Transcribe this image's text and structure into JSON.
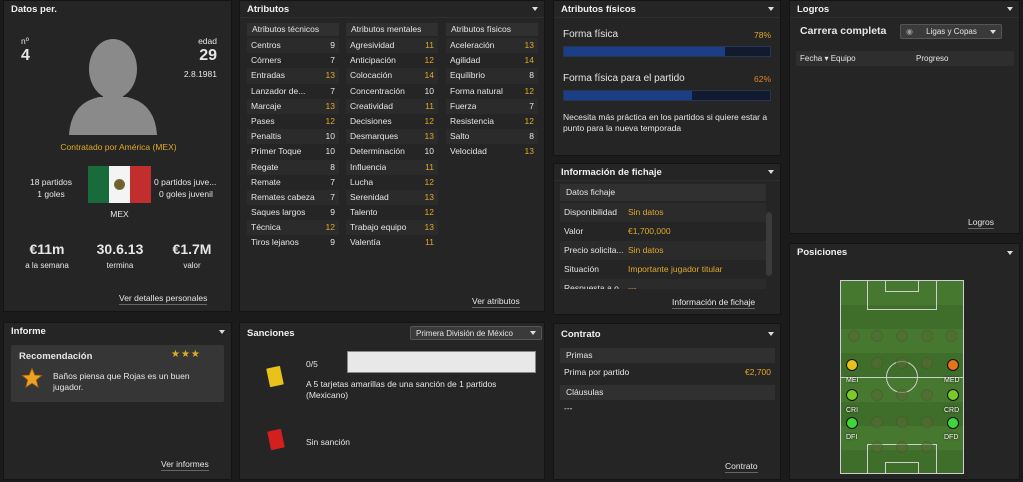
{
  "personal": {
    "title": "Datos per.",
    "num_label": "nº",
    "num": "4",
    "age_label": "edad",
    "age": "29",
    "dob": "2.8.1981",
    "contract": "Contratado por América (MEX)",
    "matches": "18 partidos",
    "goals": "1 goles",
    "youth_matches": "0 partidos juve...",
    "youth_goals": "0 goles juvenil",
    "nation": "MEX",
    "wage": "€11m",
    "wage_label": "a la semana",
    "end": "30.6.13",
    "end_label": "termina",
    "value": "€1.7M",
    "value_label": "valor",
    "link": "Ver detalles personales"
  },
  "attributes": {
    "title": "Atributos",
    "link": "Ver atributos",
    "technical": {
      "header": "Atributos técnicos",
      "rows": [
        {
          "n": "Centros",
          "v": "9"
        },
        {
          "n": "Córners",
          "v": "7"
        },
        {
          "n": "Entradas",
          "v": "13"
        },
        {
          "n": "Lanzador de...",
          "v": "7"
        },
        {
          "n": "Marcaje",
          "v": "13"
        },
        {
          "n": "Pases",
          "v": "12"
        },
        {
          "n": "Penaltis",
          "v": "10"
        },
        {
          "n": "Primer Toque",
          "v": "10"
        },
        {
          "n": "Regate",
          "v": "8"
        },
        {
          "n": "Remate",
          "v": "7"
        },
        {
          "n": "Remates cabeza",
          "v": "7"
        },
        {
          "n": "Saques largos",
          "v": "9"
        },
        {
          "n": "Técnica",
          "v": "12"
        },
        {
          "n": "Tiros lejanos",
          "v": "9"
        }
      ]
    },
    "mental": {
      "header": "Atributos mentales",
      "rows": [
        {
          "n": "Agresividad",
          "v": "11"
        },
        {
          "n": "Anticipación",
          "v": "12"
        },
        {
          "n": "Colocación",
          "v": "14"
        },
        {
          "n": "Concentración",
          "v": "10"
        },
        {
          "n": "Creatividad",
          "v": "11"
        },
        {
          "n": "Decisiones",
          "v": "12"
        },
        {
          "n": "Desmarques",
          "v": "13"
        },
        {
          "n": "Determinación",
          "v": "10"
        },
        {
          "n": "Influencia",
          "v": "11"
        },
        {
          "n": "Lucha",
          "v": "12"
        },
        {
          "n": "Serenidad",
          "v": "13"
        },
        {
          "n": "Talento",
          "v": "12"
        },
        {
          "n": "Trabajo equipo",
          "v": "13"
        },
        {
          "n": "Valentía",
          "v": "11"
        }
      ]
    },
    "physical": {
      "header": "Atributos físicos",
      "rows": [
        {
          "n": "Aceleración",
          "v": "13"
        },
        {
          "n": "Agilidad",
          "v": "14"
        },
        {
          "n": "Equilibrio",
          "v": "8"
        },
        {
          "n": "Forma natural",
          "v": "12"
        },
        {
          "n": "Fuerza",
          "v": "7"
        },
        {
          "n": "Resistencia",
          "v": "12"
        },
        {
          "n": "Salto",
          "v": "8"
        },
        {
          "n": "Velocidad",
          "v": "13"
        }
      ]
    }
  },
  "fitness": {
    "title": "Atributos físicos",
    "form_label": "Forma física",
    "form_value": "78%",
    "form_pct": 78,
    "match_label": "Forma física para el partido",
    "match_value": "62%",
    "match_pct": 62,
    "note": "Necesita más práctica en los partidos si quiere estar a punto para la nueva temporada"
  },
  "transfer": {
    "title": "Información de fichaje",
    "section": "Datos fichaje",
    "rows": [
      {
        "k": "Disponibilidad",
        "v": "Sin datos"
      },
      {
        "k": "Valor",
        "v": "€1,700,000"
      },
      {
        "k": "Precio solicita...",
        "v": "Sin datos"
      },
      {
        "k": "Situación",
        "v": "Importante jugador titular"
      },
      {
        "k": "Respuesta a o...",
        "v": "---"
      }
    ],
    "link": "Información de fichaje"
  },
  "achievements": {
    "title": "Logros",
    "career": "Carrera completa",
    "filter": "Ligas y Copas",
    "col_date": "Fecha",
    "col_team": "Equipo",
    "col_progress": "Progreso",
    "link": "Logros"
  },
  "positions": {
    "title": "Posiciones",
    "labels": [
      "MEI",
      "MED",
      "CRI",
      "CRD",
      "DFI",
      "DFD"
    ]
  },
  "report": {
    "title": "Informe",
    "rec_title": "Recomendación",
    "stars": "★★★",
    "rec_text": "Baños piensa que Rojas es un buen jugador.",
    "link": "Ver informes"
  },
  "sanctions": {
    "title": "Sanciones",
    "league": "Primera División de México",
    "count": "0/5",
    "yellow_text": "A 5 tarjetas amarillas de una sanción de 1 partidos (Mexicano)",
    "red_text": "Sin sanción"
  },
  "contract": {
    "title": "Contrato",
    "bonuses": "Primas",
    "bonus_label": "Prima por partido",
    "bonus_value": "€2,700",
    "clauses": "Cláusulas",
    "clauses_value": "---",
    "link": "Contrato"
  },
  "colors": {
    "accent": "#e0a92a",
    "bar": "#1b3e86",
    "panel": "#252525"
  }
}
